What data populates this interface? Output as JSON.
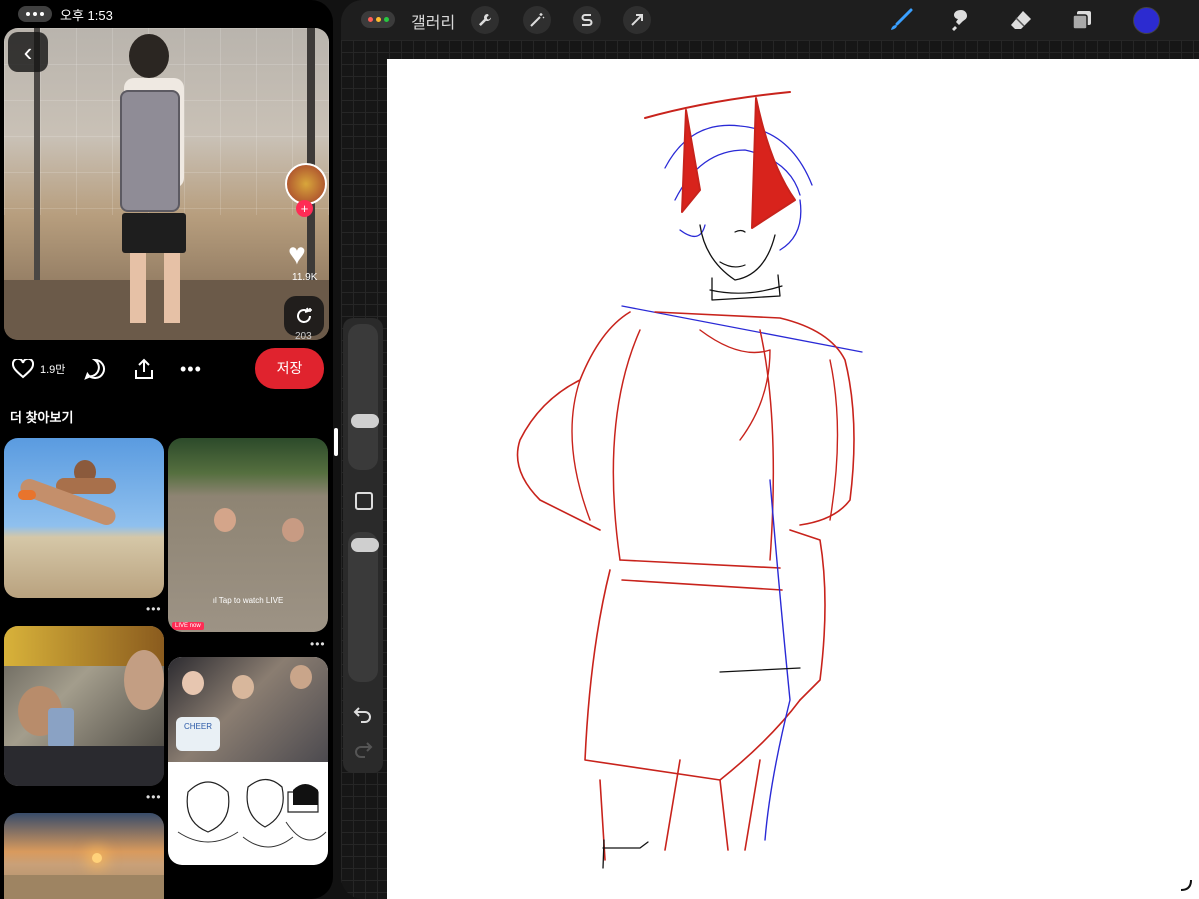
{
  "status_bar": {
    "time": "오후 1:53"
  },
  "pin_detail": {
    "back_label": "‹",
    "overlay_like_count": "11.9K",
    "overlay_bottom_count": "203",
    "likes": "1.9만",
    "save_label": "저장"
  },
  "more_section": {
    "title": "더 찾아보기",
    "pins": [
      {
        "id": "beach-jump",
        "dots": "•••"
      },
      {
        "id": "mud-bath-live",
        "dots": "•••",
        "caption": "Tap to watch LIVE",
        "badge": "LIVE now"
      },
      {
        "id": "subway-phone",
        "dots": "•••"
      },
      {
        "id": "group-photo-sketch",
        "dots": "•••",
        "sign": "CHEER"
      },
      {
        "id": "desert-sunset"
      }
    ]
  },
  "procreate": {
    "gallery_label": "갤러리",
    "tools_left": [
      "wrench-icon",
      "magic-wand-icon",
      "selection-s-icon",
      "transform-arrow-icon"
    ],
    "tools_right": [
      "brush-icon",
      "smudge-icon",
      "eraser-icon",
      "layers-icon"
    ],
    "active_color": "#2c2bd0",
    "brush_active_color": "#3aa0ff",
    "sidebar": {
      "brush_size_level": 0.42,
      "opacity_level": 0.05
    }
  },
  "colors": {
    "save_red": "#e0232e",
    "sketch_red": "#c8231c",
    "sketch_blue": "#2a2ad6",
    "sketch_black": "#111111",
    "tiktok_pink": "#fe2c55"
  }
}
